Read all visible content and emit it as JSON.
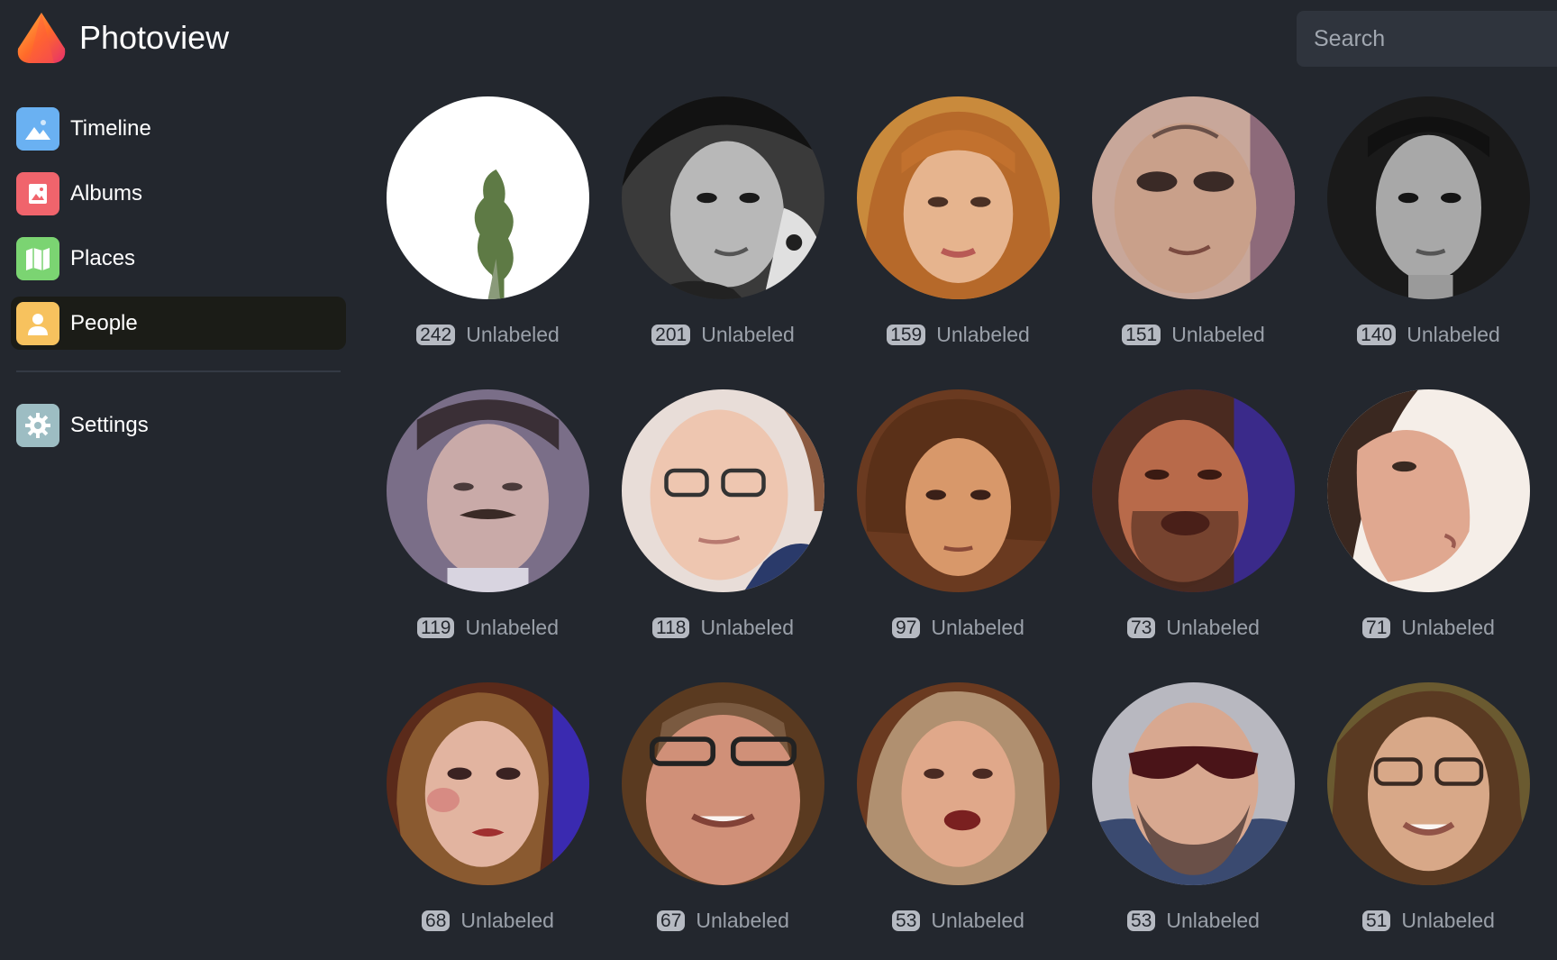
{
  "app": {
    "title": "Photoview",
    "icon": "photoview-logo-icon"
  },
  "search": {
    "placeholder": "Search",
    "value": ""
  },
  "sidebar": {
    "items": [
      {
        "label": "Timeline",
        "icon": "timeline-icon",
        "color": "#6ab1f2",
        "active": false
      },
      {
        "label": "Albums",
        "icon": "albums-icon",
        "color": "#f0646c",
        "active": false
      },
      {
        "label": "Places",
        "icon": "places-icon",
        "color": "#7bd472",
        "active": false
      },
      {
        "label": "People",
        "icon": "people-icon",
        "color": "#f7c25e",
        "active": true
      }
    ],
    "settings": {
      "label": "Settings",
      "icon": "gear-icon",
      "color": "#9dbdc3"
    }
  },
  "people": [
    {
      "count": "242",
      "name": "Unlabeled"
    },
    {
      "count": "201",
      "name": "Unlabeled"
    },
    {
      "count": "159",
      "name": "Unlabeled"
    },
    {
      "count": "151",
      "name": "Unlabeled"
    },
    {
      "count": "140",
      "name": "Unlabeled"
    },
    {
      "count": "119",
      "name": "Unlabeled"
    },
    {
      "count": "118",
      "name": "Unlabeled"
    },
    {
      "count": "97",
      "name": "Unlabeled"
    },
    {
      "count": "73",
      "name": "Unlabeled"
    },
    {
      "count": "71",
      "name": "Unlabeled"
    },
    {
      "count": "68",
      "name": "Unlabeled"
    },
    {
      "count": "67",
      "name": "Unlabeled"
    },
    {
      "count": "53",
      "name": "Unlabeled"
    },
    {
      "count": "53",
      "name": "Unlabeled"
    },
    {
      "count": "51",
      "name": "Unlabeled"
    }
  ],
  "colors": {
    "background": "#23272e",
    "active_nav": "#1b1c17",
    "badge": "#b6bac2",
    "label": "#9aa0a9"
  }
}
